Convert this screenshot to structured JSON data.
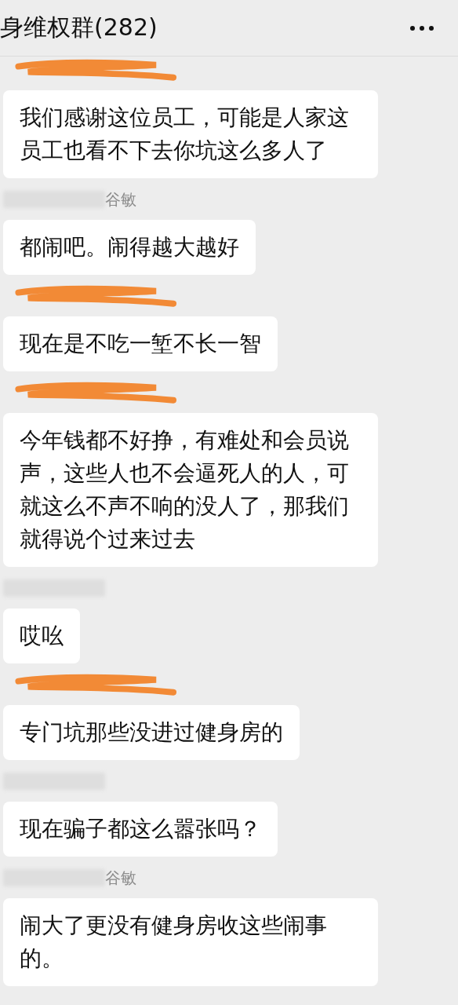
{
  "header": {
    "title": "身维权群(282)"
  },
  "messages": [
    {
      "sender": {
        "kind": "scribble"
      },
      "text": "我们感谢这位员工，可能是人家这员工也看不下去你坑这么多人了"
    },
    {
      "sender": {
        "kind": "blur",
        "name": "谷敏"
      },
      "text": "都闹吧。闹得越大越好"
    },
    {
      "sender": {
        "kind": "scribble"
      },
      "text": "现在是不吃一堑不长一智"
    },
    {
      "sender": {
        "kind": "scribble"
      },
      "text": "今年钱都不好挣，有难处和会员说声，这些人也不会逼死人的人，可就这么不声不响的没人了，那我们就得说个过来过去"
    },
    {
      "sender": {
        "kind": "blur"
      },
      "text": "哎吆"
    },
    {
      "sender": {
        "kind": "scribble"
      },
      "text": "专门坑那些没进过健身房的"
    },
    {
      "sender": {
        "kind": "blur"
      },
      "text": "现在骗子都这么嚣张吗？"
    },
    {
      "sender": {
        "kind": "blur",
        "name": "谷敏"
      },
      "text": "闹大了更没有健身房收这些闹事的。"
    }
  ]
}
